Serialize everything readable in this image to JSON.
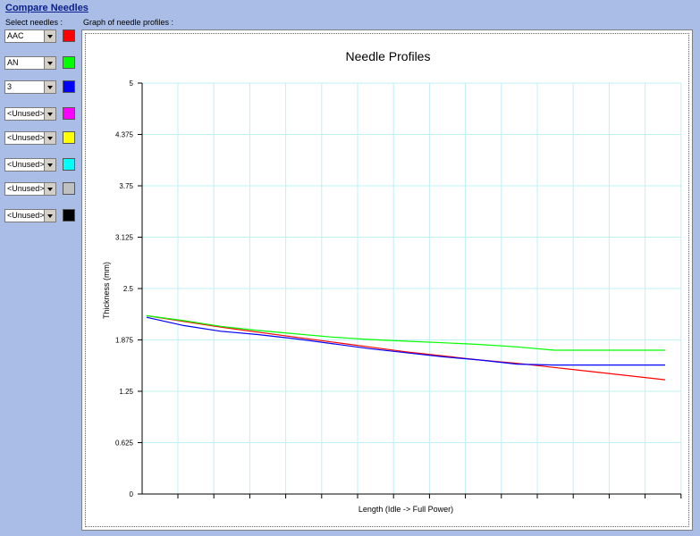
{
  "header": {
    "title": "Compare Needles",
    "select_label": "Select needles :",
    "graph_label": "Graph of needle profiles :"
  },
  "needles": [
    {
      "value": "AAC",
      "color": "#ff0000"
    },
    {
      "value": "AN",
      "color": "#00ff00"
    },
    {
      "value": "3",
      "color": "#0000ff"
    },
    {
      "value": "<Unused>",
      "color": "#ff00ff"
    },
    {
      "value": "<Unused>",
      "color": "#ffff00"
    },
    {
      "value": "<Unused>",
      "color": "#00ffff"
    },
    {
      "value": "<Unused>",
      "color": "#c0c0c0"
    },
    {
      "value": "<Unused>",
      "color": "#000000"
    }
  ],
  "chart_data": {
    "type": "line",
    "title": "Needle Profiles",
    "xlabel": "Length (Idle -> Full Power)",
    "ylabel": "Thickness (mm)",
    "ylim": [
      0,
      5
    ],
    "yticks": [
      "0",
      "0.625",
      "1.25",
      "1.875",
      "2.5",
      "3.125",
      "3.75",
      "4.375",
      "5"
    ],
    "grid": true,
    "x": [
      0,
      1,
      2,
      3,
      4,
      5,
      6,
      7,
      8,
      9,
      10,
      11,
      12,
      13,
      14
    ],
    "series": [
      {
        "color": "#ff0000",
        "values": [
          2.17,
          2.1,
          2.03,
          1.97,
          1.91,
          1.85,
          1.79,
          1.73,
          1.68,
          1.63,
          1.59,
          1.54,
          1.49,
          1.44,
          1.39
        ]
      },
      {
        "color": "#00ff00",
        "values": [
          2.17,
          2.11,
          2.04,
          1.99,
          1.95,
          1.91,
          1.88,
          1.86,
          1.84,
          1.82,
          1.79,
          1.75,
          1.75,
          1.75,
          1.75
        ]
      },
      {
        "color": "#0000ff",
        "values": [
          2.15,
          2.05,
          1.98,
          1.94,
          1.89,
          1.83,
          1.77,
          1.72,
          1.67,
          1.63,
          1.58,
          1.57,
          1.57,
          1.57,
          1.57
        ]
      }
    ]
  }
}
